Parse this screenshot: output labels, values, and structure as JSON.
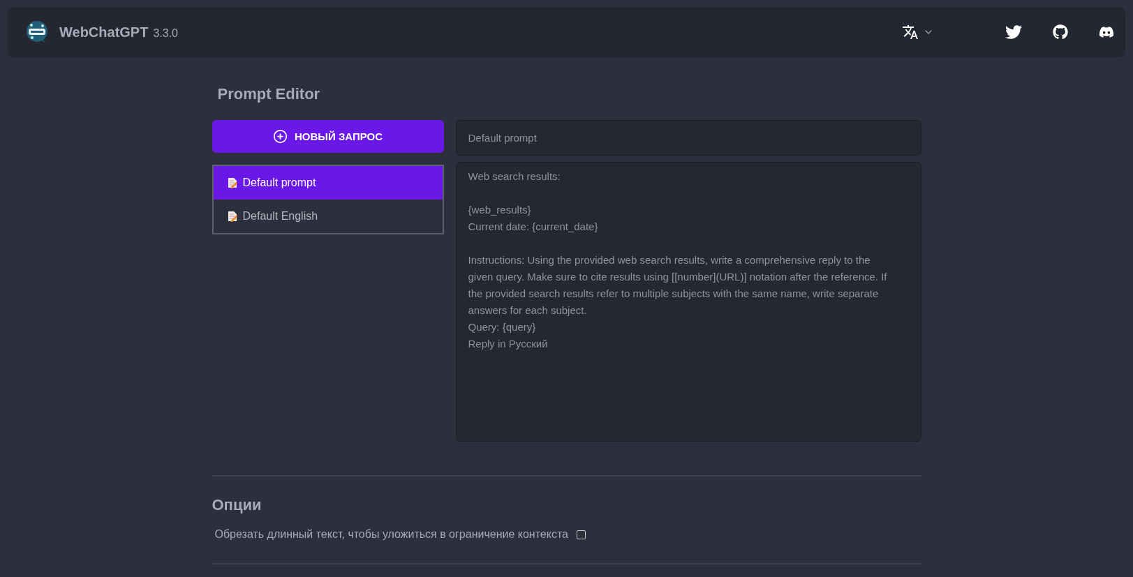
{
  "header": {
    "title": "WebChatGPT",
    "version": "3.3.0"
  },
  "page_title": "Prompt Editor",
  "new_prompt_button": "НОВЫЙ ЗАПРОС",
  "prompts": [
    {
      "label": "Default prompt",
      "selected": true
    },
    {
      "label": "Default English",
      "selected": false
    }
  ],
  "prompt_name": {
    "value": "Default prompt"
  },
  "prompt_text": {
    "value": "Web search results:\n\n{web_results}\nCurrent date: {current_date}\n\nInstructions: Using the provided web search results, write a comprehensive reply to the given query. Make sure to cite results using [[number](URL)] notation after the reference. If the provided search results refer to multiple subjects with the same name, write separate answers for each subject.\nQuery: {query}\nReply in Русский"
  },
  "options": {
    "title": "Опции",
    "items": [
      {
        "label": "Обрезать длинный текст, чтобы уложиться в ограничение контекста",
        "checked": false
      }
    ]
  }
}
